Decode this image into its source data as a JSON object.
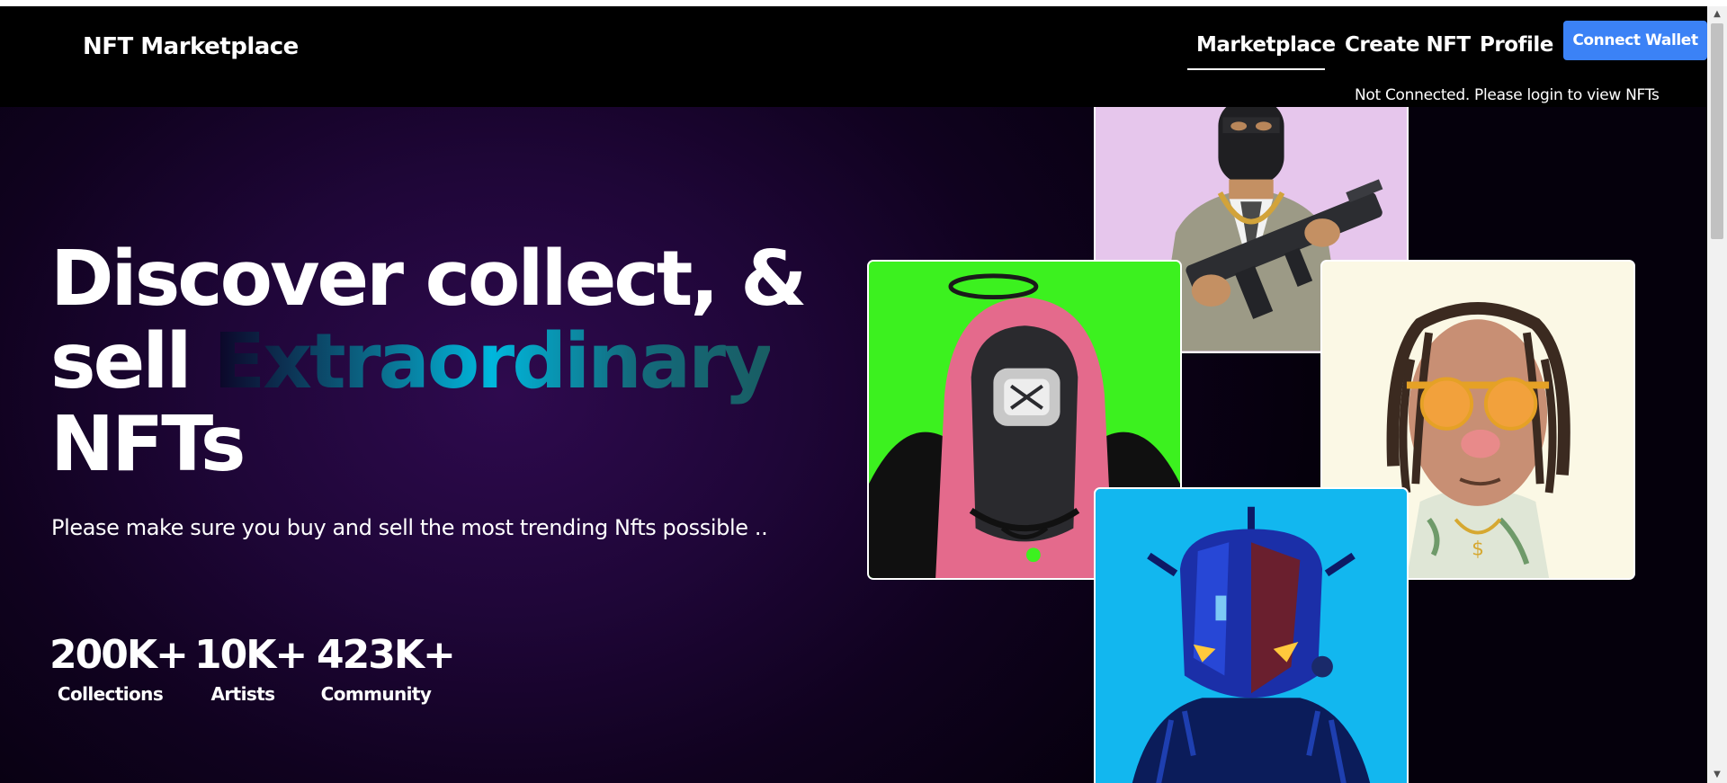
{
  "navbar": {
    "brand": "NFT Marketplace",
    "links": [
      {
        "label": "Marketplace",
        "active": true
      },
      {
        "label": "Create NFT"
      },
      {
        "label": "Profile"
      }
    ],
    "connect_button": "Connect Wallet",
    "status": "Not Connected. Please login to view NFTs"
  },
  "hero": {
    "title_line1": "Discover collect, &",
    "title_line2_prefix": "sell",
    "title_highlight": "Extraordinary",
    "title_line3": "NFTs",
    "subtitle": "Please make sure you buy and sell the most trending Nfts possible .."
  },
  "stats": [
    {
      "value": "200K+",
      "label": "Collections"
    },
    {
      "value": "10K+",
      "label": "Artists"
    },
    {
      "value": "423K+",
      "label": "Community"
    }
  ],
  "nft_cards": [
    {
      "name": "masked-gunman",
      "background": "#e6c6ec"
    },
    {
      "name": "pink-hooded-figure",
      "background": "#3cf11f"
    },
    {
      "name": "dreadlock-ape",
      "background": "#fbf8e5"
    },
    {
      "name": "blue-robot",
      "background": "#12b7ef"
    }
  ],
  "colors": {
    "accent_button": "#3b82f6",
    "navbar_bg": "#000000",
    "hero_bg": "#1f0638"
  },
  "scrollbar": {
    "up_icon": "arrow-up-icon",
    "down_icon": "arrow-down-icon"
  }
}
